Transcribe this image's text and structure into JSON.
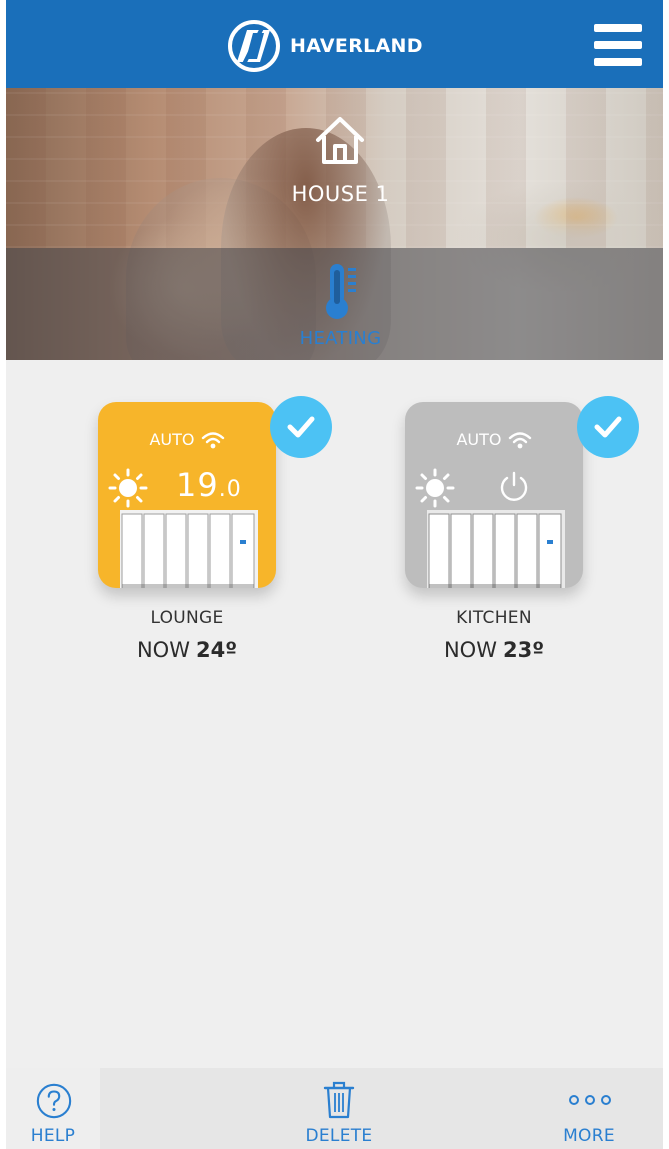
{
  "header": {
    "brand_name": "HAVERLAND",
    "logo_icon": "haverland-logo-icon",
    "menu_icon": "hamburger-menu-icon",
    "background_color": "#1a6fba"
  },
  "hero": {
    "house_label": "HOUSE 1",
    "house_icon": "house-icon",
    "section_label": "HEATING",
    "section_icon": "thermometer-icon"
  },
  "devices": [
    {
      "name": "LOUNGE",
      "mode": "AUTO",
      "setpoint_int": "19",
      "setpoint_dec": ".0",
      "temp_prefix": "NOW",
      "temp_value": "24º",
      "card_color": "#f7b52a",
      "selected": true,
      "icons": [
        "wifi-icon",
        "sun-icon",
        "radiator-icon",
        "check-icon"
      ]
    },
    {
      "name": "KITCHEN",
      "mode": "AUTO",
      "temp_prefix": "NOW",
      "temp_value": "23º",
      "card_color": "#bdbdbd",
      "selected": true,
      "icons": [
        "wifi-icon",
        "sun-icon",
        "power-icon",
        "radiator-icon",
        "check-icon"
      ]
    }
  ],
  "bottom_bar": {
    "help_label": "HELP",
    "delete_label": "DELETE",
    "more_label": "MORE",
    "accent_color": "#2a7fd0"
  },
  "colors": {
    "check_badge": "#4cc2f4",
    "page_background": "#efefef"
  }
}
